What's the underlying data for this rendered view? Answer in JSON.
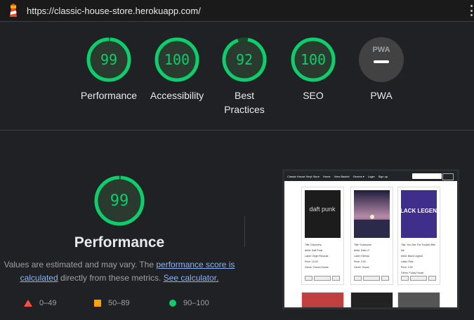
{
  "browser": {
    "url": "https://classic-house-store.herokuapp.com/"
  },
  "summary_gauges": [
    {
      "score": "99",
      "label_line1": "Performance",
      "label_line2": "",
      "color": "#0cce6b"
    },
    {
      "score": "100",
      "label_line1": "Accessibility",
      "label_line2": "",
      "color": "#0cce6b"
    },
    {
      "score": "92",
      "label_line1": "Best",
      "label_line2": "Practices",
      "color": "#0cce6b"
    },
    {
      "score": "100",
      "label_line1": "SEO",
      "label_line2": "",
      "color": "#0cce6b"
    },
    {
      "badge": "PWA",
      "label_line1": "PWA",
      "label_line2": "",
      "color": "#9aa0a6"
    }
  ],
  "performance": {
    "score": "99",
    "title": "Performance",
    "desc_prefix": "Values are estimated and may vary. The ",
    "link_score": "performance score is calculated",
    "desc_middle": " directly from these metrics. ",
    "link_calculator": "See calculator.",
    "desc_suffix": ""
  },
  "legend": [
    {
      "shape": "triangle",
      "range": "0–49",
      "color": "#ff4e42"
    },
    {
      "shape": "square",
      "range": "50–89",
      "color": "#ffa400"
    },
    {
      "shape": "circle",
      "range": "90–100",
      "color": "#0cce6b"
    }
  ],
  "screenshot": {
    "brand": "Classic House Vinyl Store",
    "nav": [
      "Home",
      "View Basket",
      "Genres ▾",
      "Login",
      "Sign up"
    ],
    "search_placeholder": "Search",
    "search_button": "Search",
    "cards": [
      {
        "art": "daft punk",
        "title": "Title: Discovery",
        "artist": "Artist: Daft Punk",
        "label": "Label: Virgin Records",
        "price": "Price: 15.00",
        "genre": "Genre: French House"
      },
      {
        "art": "",
        "title": "Title: Sunchyme",
        "artist": "Artist: Dario G",
        "label": "Label: Eternal",
        "price": "Price: 3.00",
        "genre": "Genre: House"
      },
      {
        "art": "BLACK LEGEND",
        "title": "Title: You See The Trouble With Me",
        "artist": "Artist: Black Legend",
        "label": "Label: Rise",
        "price": "Price: 3.00",
        "genre": "Genre: Funky House"
      }
    ]
  }
}
